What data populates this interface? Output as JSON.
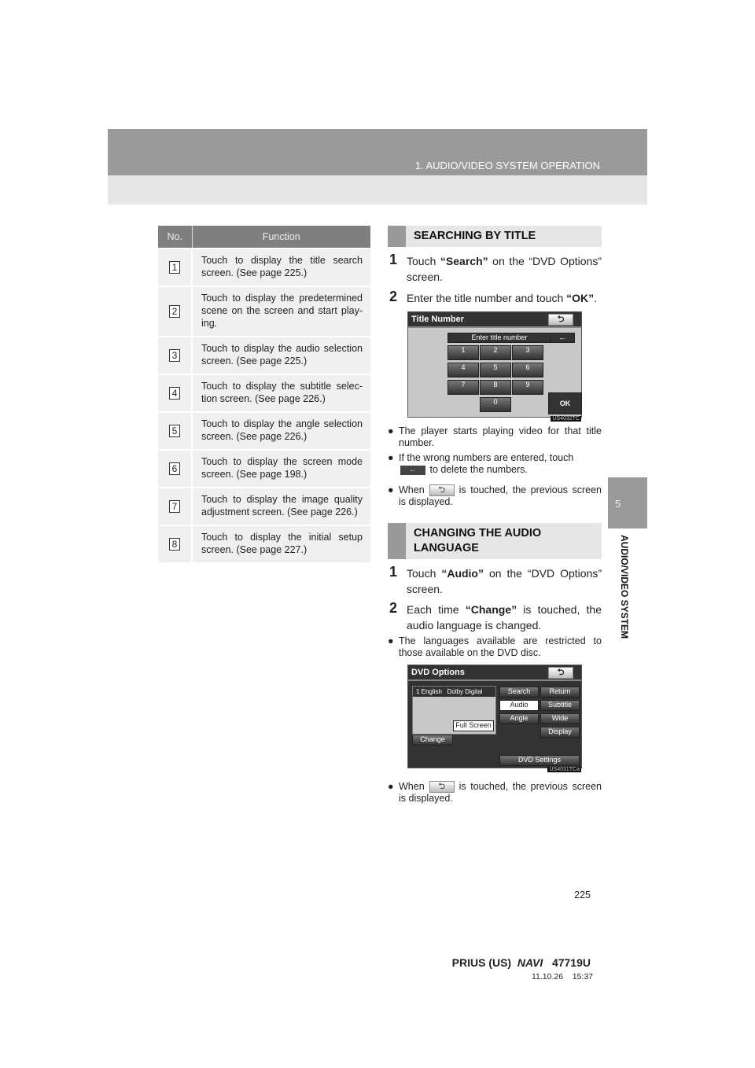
{
  "header": {
    "title": "1. AUDIO/VIDEO SYSTEM OPERATION"
  },
  "side_tab": {
    "number": "5",
    "label": "AUDIO/VIDEO SYSTEM"
  },
  "table": {
    "headers": [
      "No.",
      "Function"
    ],
    "rows": [
      {
        "no": "1",
        "text": "Touch to display the title search screen. (See page 225.)"
      },
      {
        "no": "2",
        "text": "Touch to display the predetermined scene on the screen and start play-ing."
      },
      {
        "no": "3",
        "text": "Touch to display the audio selection screen. (See page 225.)"
      },
      {
        "no": "4",
        "text": "Touch to display the subtitle selec-tion screen. (See page 226.)"
      },
      {
        "no": "5",
        "text": "Touch to display the angle selection screen. (See page 226.)"
      },
      {
        "no": "6",
        "text": "Touch to display the screen mode screen. (See page 198.)"
      },
      {
        "no": "7",
        "text": "Touch to display the image quality adjustment screen. (See page 226.)"
      },
      {
        "no": "8",
        "text": "Touch to display the initial setup screen. (See page 227.)"
      }
    ]
  },
  "sec1": {
    "title": "SEARCHING BY TITLE",
    "step1": {
      "n": "1",
      "pre": "Touch ",
      "bold": "“Search”",
      "post": " on the “DVD Options” screen."
    },
    "step2": {
      "n": "2",
      "pre": "Enter the title number and touch ",
      "bold": "“OK”",
      "post": "."
    },
    "screen": {
      "title": "Title Number",
      "field": "Enter title number",
      "keys": [
        "1",
        "2",
        "3",
        "4",
        "5",
        "6",
        "7",
        "8",
        "9",
        "0"
      ],
      "ok": "OK",
      "code": "US4032TC"
    },
    "b1": "The player starts playing video for that title number.",
    "b2a": "If the wrong numbers are entered, touch",
    "b2b": "to delete the numbers.",
    "b3a": "When",
    "b3b": "is touched, the previous screen is displayed."
  },
  "sec2": {
    "title": "CHANGING THE AUDIO LANGUAGE",
    "step1": {
      "n": "1",
      "pre": "Touch ",
      "bold": "“Audio”",
      "post": " on the “DVD Options” screen."
    },
    "step2": {
      "n": "2",
      "pre": "Each time ",
      "bold": "“Change”",
      "post": " is touched, the audio language is changed."
    },
    "b1": "The languages available are restricted to those available on the DVD disc.",
    "screen": {
      "title": "DVD Options",
      "lang": "1  English",
      "fmt": "Dolby Digital",
      "full": "Full Screen",
      "change": "Change",
      "buttons": [
        "Search",
        "Return",
        "Audio",
        "Subtitle",
        "Angle",
        "Wide",
        "Display"
      ],
      "settings": "DVD Settings",
      "code": "US4031TCa"
    },
    "b2a": "When",
    "b2b": "is touched, the previous screen is displayed."
  },
  "footer": {
    "page": "225",
    "model": "PRIUS (US)",
    "navi": "NAVI",
    "code": "47719U",
    "date": "11.10.26",
    "time": "15:37"
  }
}
